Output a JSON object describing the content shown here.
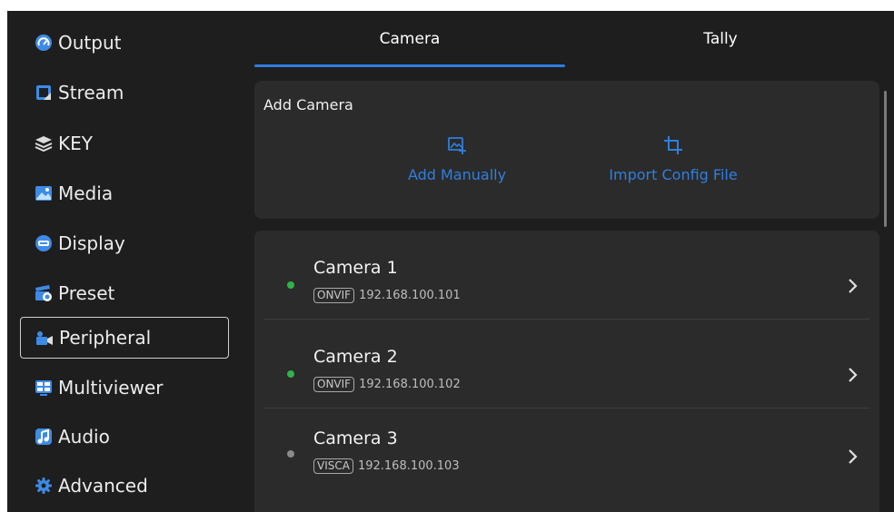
{
  "sidebar": {
    "items": [
      {
        "label": "Output",
        "icon": "output-gauge-icon",
        "color": "#3d8be6"
      },
      {
        "label": "Stream",
        "icon": "stream-icon",
        "color": "#3d8be6"
      },
      {
        "label": "KEY",
        "icon": "layers-icon",
        "color": "#dcdcdc"
      },
      {
        "label": "Media",
        "icon": "image-icon",
        "color": "#3d8be6"
      },
      {
        "label": "Display",
        "icon": "display-icon",
        "color": "#3d8be6"
      },
      {
        "label": "Preset",
        "icon": "preset-icon",
        "color": "#3d8be6"
      },
      {
        "label": "Peripheral",
        "icon": "camera-peripheral-icon",
        "color": "#3d8be6",
        "active": true
      },
      {
        "label": "Multiviewer",
        "icon": "multiviewer-icon",
        "color": "#3d8be6"
      },
      {
        "label": "Audio",
        "icon": "audio-note-icon",
        "color": "#3d8be6"
      },
      {
        "label": "Advanced",
        "icon": "advanced-gear-icon",
        "color": "#3d8be6"
      }
    ]
  },
  "tabs": [
    {
      "label": "Camera",
      "active": true
    },
    {
      "label": "Tally",
      "active": false
    }
  ],
  "add_camera": {
    "title": "Add Camera",
    "actions": [
      {
        "label": "Add Manually",
        "icon": "add-image-icon"
      },
      {
        "label": "Import Config File",
        "icon": "crop-icon"
      }
    ]
  },
  "cameras": [
    {
      "name": "Camera 1",
      "protocol": "ONVIF",
      "ip": "192.168.100.101",
      "status": "online"
    },
    {
      "name": "Camera 2",
      "protocol": "ONVIF",
      "ip": "192.168.100.102",
      "status": "online"
    },
    {
      "name": "Camera 3",
      "protocol": "VISCA",
      "ip": "192.168.100.103",
      "status": "offline"
    }
  ],
  "colors": {
    "accent": "#2e7de0",
    "online": "#2fb34a",
    "offline": "#8a8a8a",
    "background": "#1e1e1e",
    "card": "#2b2b2b"
  }
}
